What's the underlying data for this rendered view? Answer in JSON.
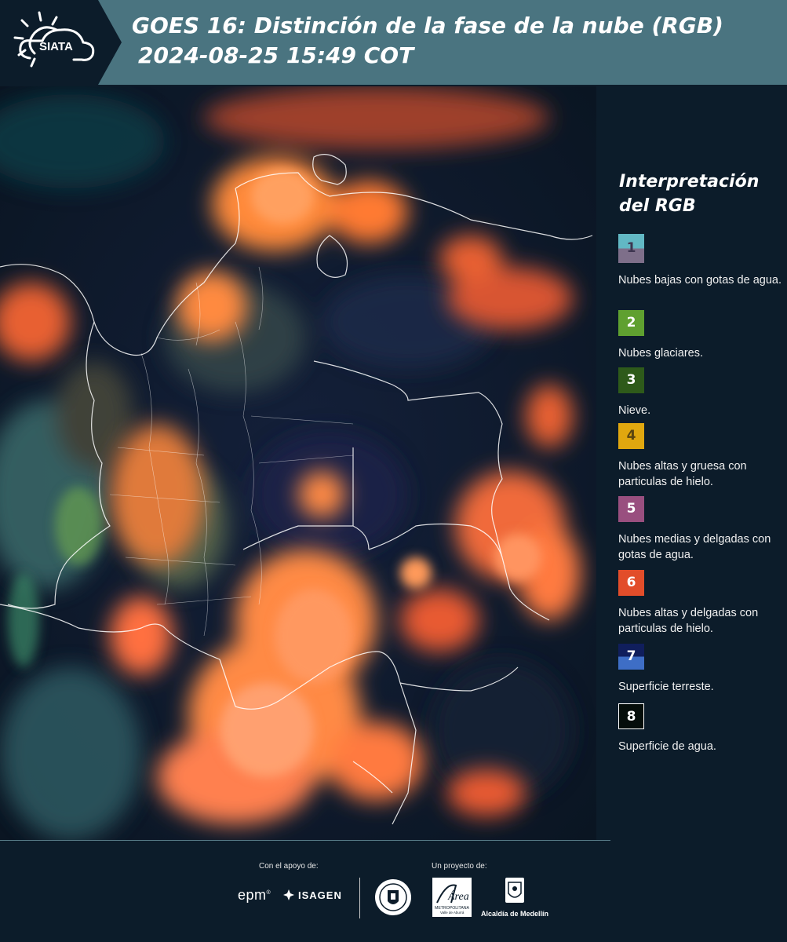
{
  "header": {
    "title_line1": "GOES 16: Distinción de la fase de la nube (RGB)",
    "title_line2": "2024-08-25 15:49 COT",
    "logo_text": "SIATA"
  },
  "legend": {
    "title": "Interpretación del RGB",
    "items": [
      {
        "number": "1",
        "label": "Nubes bajas con gotas de agua.",
        "colors": [
          "#62b8c4",
          "#7e6f8a"
        ]
      },
      {
        "number": "2",
        "label": "Nubes glaciares.",
        "colors": [
          "#5fa030"
        ]
      },
      {
        "number": "3",
        "label": "Nieve.",
        "colors": [
          "#2e5a1a"
        ]
      },
      {
        "number": "4",
        "label": "Nubes altas y gruesa con particulas de hielo.",
        "colors": [
          "#e0a70f"
        ]
      },
      {
        "number": "5",
        "label": "Nubes medias y delgadas con gotas de agua.",
        "colors": [
          "#994f7f"
        ]
      },
      {
        "number": "6",
        "label": "Nubes altas y delgadas con particulas de hielo.",
        "colors": [
          "#e24d2a"
        ]
      },
      {
        "number": "7",
        "label": "Superficie terreste.",
        "colors": [
          "#101e5c",
          "#3e6ec6"
        ]
      },
      {
        "number": "8",
        "label": "Superficie de agua.",
        "colors": [
          "#050d0a"
        ]
      }
    ]
  },
  "footer": {
    "support_label": "Con el apoyo de:",
    "project_label": "Un proyecto de:",
    "sponsor1": "epm",
    "sponsor2": "ISAGEN",
    "area_logo_text": "Área",
    "area_sub1": "METROPOLITANA",
    "area_sub2": "Valle de Aburrá",
    "alcaldia": "Alcaldía de Medellín"
  },
  "colors": {
    "header_bg": "#4a7480",
    "panel_bg": "#0c1c2a",
    "cloud_orange": "#ff7a3a"
  }
}
